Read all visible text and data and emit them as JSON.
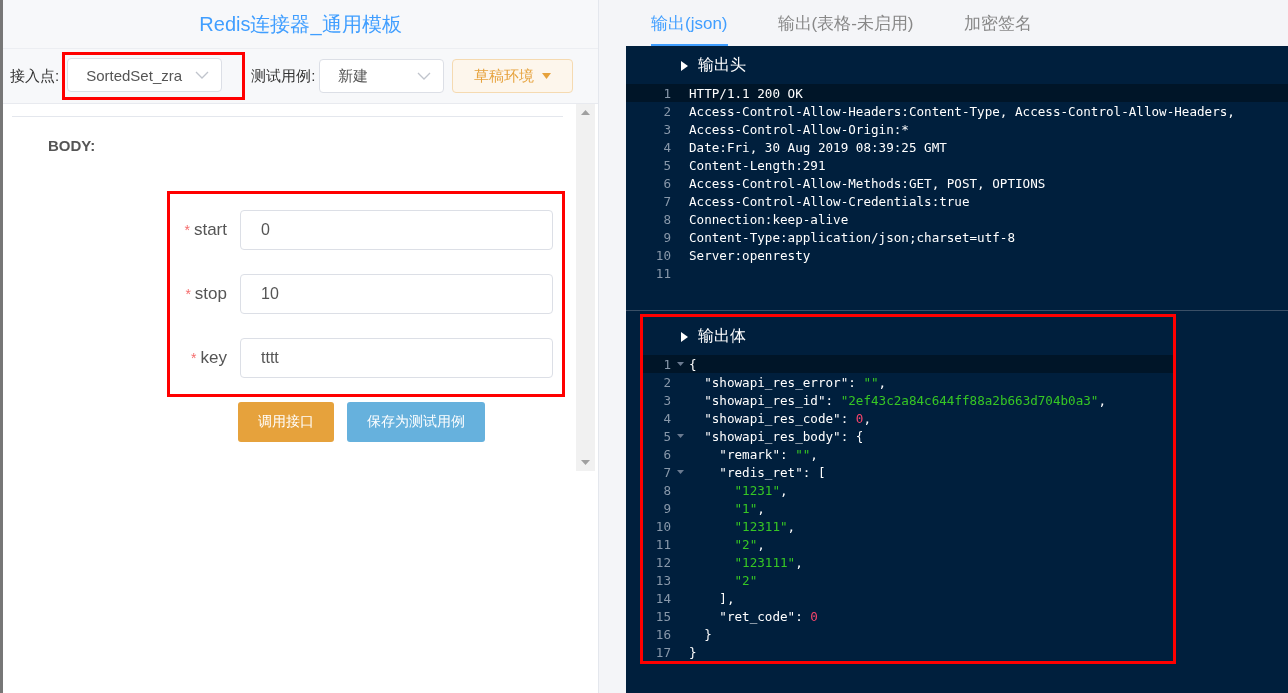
{
  "left_panel": {
    "title": "Redis连接器_通用模板",
    "toolbar": {
      "endpoint_label": "接入点:",
      "endpoint_value": "SortedSet_zra",
      "endpoint_highlighted": true,
      "testcase_label": "测试用例:",
      "testcase_value": "新建",
      "env_button": "草稿环境"
    },
    "body_label": "BODY:",
    "form_highlighted": true,
    "fields": [
      {
        "label": "start",
        "required_mark": "*",
        "value": "0"
      },
      {
        "label": "stop",
        "required_mark": "*",
        "value": "10"
      },
      {
        "label": "key",
        "required_mark": "*",
        "value": "tttt"
      }
    ],
    "buttons": [
      {
        "label": "调用接口",
        "kind": "primary"
      },
      {
        "label": "保存为测试用例",
        "kind": "secondary"
      }
    ]
  },
  "right_panel": {
    "tabs": [
      {
        "label": "输出(json)",
        "selected": true
      },
      {
        "label": "输出(表格-未启用)",
        "selected": false
      },
      {
        "label": "加密签名",
        "selected": false
      }
    ],
    "sections": [
      {
        "title": "输出头",
        "highlighted": false,
        "lines": [
          {
            "number": "1",
            "active": true,
            "foldable": false,
            "tokens": [
              {
                "kind": "text",
                "text": "HTTP/1.1 200 OK"
              }
            ]
          },
          {
            "number": "2",
            "active": false,
            "foldable": false,
            "tokens": [
              {
                "kind": "text",
                "text": "Access-Control-Allow-Headers:Content-Type, Access-Control-Allow-Headers,"
              }
            ]
          },
          {
            "number": "3",
            "active": false,
            "foldable": false,
            "tokens": [
              {
                "kind": "text",
                "text": "Access-Control-Allow-Origin:*"
              }
            ]
          },
          {
            "number": "4",
            "active": false,
            "foldable": false,
            "tokens": [
              {
                "kind": "text",
                "text": "Date:Fri, 30 Aug 2019 08:39:25 GMT"
              }
            ]
          },
          {
            "number": "5",
            "active": false,
            "foldable": false,
            "tokens": [
              {
                "kind": "text",
                "text": "Content-Length:291"
              }
            ]
          },
          {
            "number": "6",
            "active": false,
            "foldable": false,
            "tokens": [
              {
                "kind": "text",
                "text": "Access-Control-Allow-Methods:GET, POST, OPTIONS"
              }
            ]
          },
          {
            "number": "7",
            "active": false,
            "foldable": false,
            "tokens": [
              {
                "kind": "text",
                "text": "Access-Control-Allow-Credentials:true"
              }
            ]
          },
          {
            "number": "8",
            "active": false,
            "foldable": false,
            "tokens": [
              {
                "kind": "text",
                "text": "Connection:keep-alive"
              }
            ]
          },
          {
            "number": "9",
            "active": false,
            "foldable": false,
            "tokens": [
              {
                "kind": "text",
                "text": "Content-Type:application/json;charset=utf-8"
              }
            ]
          },
          {
            "number": "10",
            "active": false,
            "foldable": false,
            "tokens": [
              {
                "kind": "text",
                "text": "Server:openresty"
              }
            ]
          },
          {
            "number": "11",
            "active": false,
            "foldable": false
          }
        ]
      },
      {
        "title": "输出体",
        "highlighted": true,
        "lines": [
          {
            "number": "1",
            "active": true,
            "foldable": true,
            "tokens": [
              {
                "kind": "text",
                "text": "{"
              }
            ]
          },
          {
            "number": "2",
            "active": false,
            "foldable": false,
            "tokens": [
              {
                "kind": "text",
                "text": "  \"showapi_res_error\": "
              },
              {
                "kind": "string",
                "text": "\"\""
              },
              {
                "kind": "text",
                "text": ","
              }
            ]
          },
          {
            "number": "3",
            "active": false,
            "foldable": false,
            "tokens": [
              {
                "kind": "text",
                "text": "  \"showapi_res_id\": "
              },
              {
                "kind": "string",
                "text": "\"2ef43c2a84c644ff88a2b663d704b0a3\""
              },
              {
                "kind": "text",
                "text": ","
              }
            ]
          },
          {
            "number": "4",
            "active": false,
            "foldable": false,
            "tokens": [
              {
                "kind": "text",
                "text": "  \"showapi_res_code\": "
              },
              {
                "kind": "number",
                "text": "0"
              },
              {
                "kind": "text",
                "text": ","
              }
            ]
          },
          {
            "number": "5",
            "active": false,
            "foldable": true,
            "tokens": [
              {
                "kind": "text",
                "text": "  \"showapi_res_body\": {"
              }
            ]
          },
          {
            "number": "6",
            "active": false,
            "foldable": false,
            "tokens": [
              {
                "kind": "text",
                "text": "    \"remark\": "
              },
              {
                "kind": "string",
                "text": "\"\""
              },
              {
                "kind": "text",
                "text": ","
              }
            ]
          },
          {
            "number": "7",
            "active": false,
            "foldable": true,
            "tokens": [
              {
                "kind": "text",
                "text": "    \"redis_ret\": ["
              }
            ]
          },
          {
            "number": "8",
            "active": false,
            "foldable": false,
            "tokens": [
              {
                "kind": "string",
                "text": "      \"1231\""
              },
              {
                "kind": "text",
                "text": ","
              }
            ]
          },
          {
            "number": "9",
            "active": false,
            "foldable": false,
            "tokens": [
              {
                "kind": "string",
                "text": "      \"1\""
              },
              {
                "kind": "text",
                "text": ","
              }
            ]
          },
          {
            "number": "10",
            "active": false,
            "foldable": false,
            "tokens": [
              {
                "kind": "string",
                "text": "      \"12311\""
              },
              {
                "kind": "text",
                "text": ","
              }
            ]
          },
          {
            "number": "11",
            "active": false,
            "foldable": false,
            "tokens": [
              {
                "kind": "string",
                "text": "      \"2\""
              },
              {
                "kind": "text",
                "text": ","
              }
            ]
          },
          {
            "number": "12",
            "active": false,
            "foldable": false,
            "tokens": [
              {
                "kind": "string",
                "text": "      \"123111\""
              },
              {
                "kind": "text",
                "text": ","
              }
            ]
          },
          {
            "number": "13",
            "active": false,
            "foldable": false,
            "tokens": [
              {
                "kind": "string",
                "text": "      \"2\""
              }
            ]
          },
          {
            "number": "14",
            "active": false,
            "foldable": false,
            "tokens": [
              {
                "kind": "text",
                "text": "    ],"
              }
            ]
          },
          {
            "number": "15",
            "active": false,
            "foldable": false,
            "tokens": [
              {
                "kind": "text",
                "text": "    \"ret_code\": "
              },
              {
                "kind": "number",
                "text": "0"
              }
            ]
          },
          {
            "number": "16",
            "active": false,
            "foldable": false,
            "tokens": [
              {
                "kind": "text",
                "text": "  }"
              }
            ]
          },
          {
            "number": "17",
            "active": false,
            "foldable": false,
            "tokens": [
              {
                "kind": "text",
                "text": "}"
              }
            ]
          }
        ]
      }
    ]
  }
}
